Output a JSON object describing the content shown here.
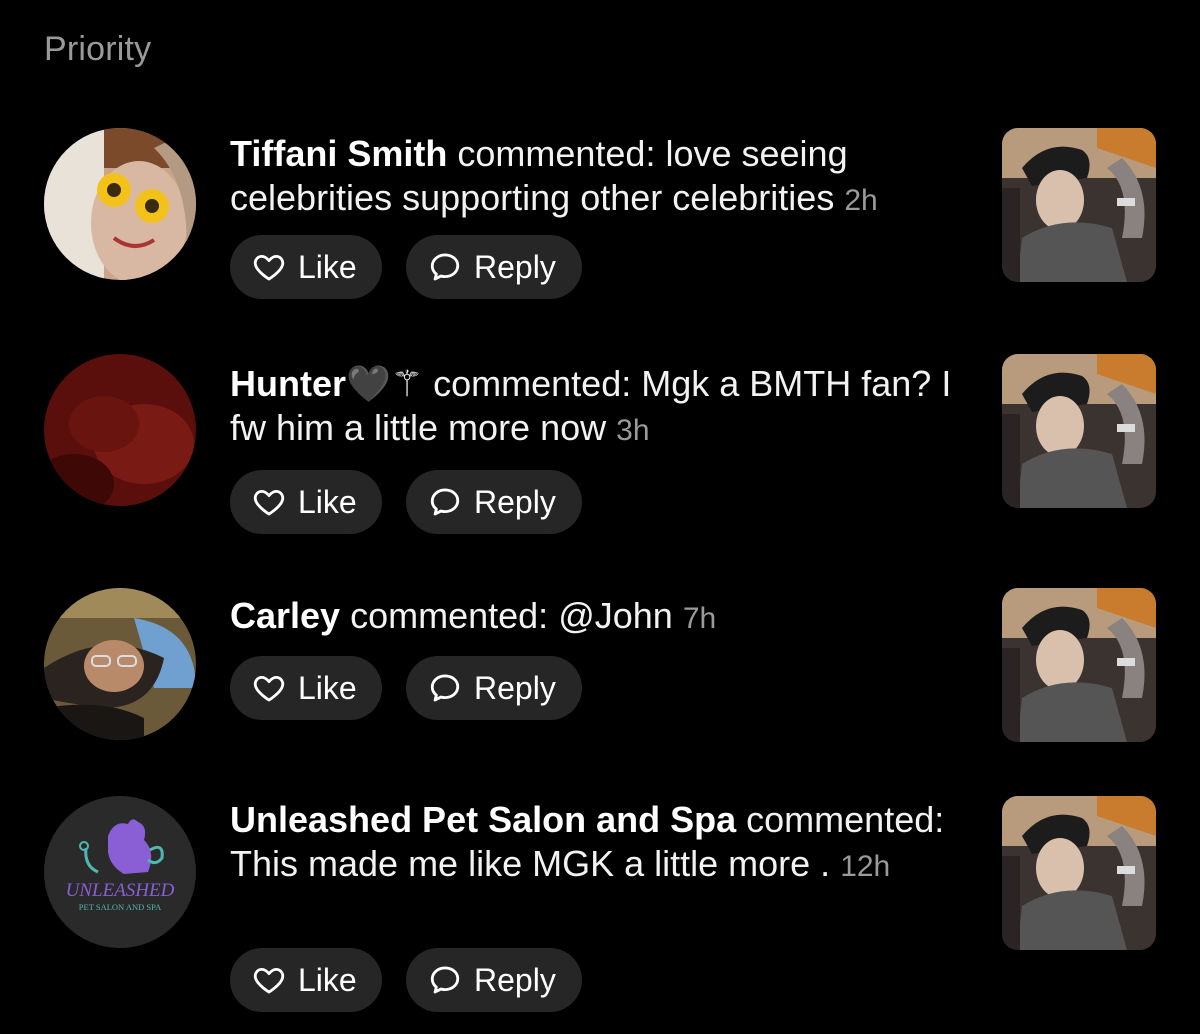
{
  "section_title": "Priority",
  "verb": "commented:",
  "like_label": "Like",
  "reply_label": "Reply",
  "notifications": [
    {
      "name": "Tiffani Smith",
      "badges": "",
      "text": "love seeing celebrities supporting other celebrities",
      "time": "2h",
      "avatar": "avatar-photo-sunflower-glasses"
    },
    {
      "name": "Hunter",
      "badges": "🖤⚚",
      "text": "Mgk a BMTH fan? I fw him a little more now",
      "time": "3h",
      "avatar": "avatar-photo-red"
    },
    {
      "name": "Carley",
      "badges": "",
      "text": "@John",
      "time": "7h",
      "avatar": "avatar-photo-woman-glasses"
    },
    {
      "name": "Unleashed Pet Salon and Spa",
      "badges": "",
      "text": "This made me like MGK a little more .",
      "time": "12h",
      "avatar": "avatar-logo-unleashed",
      "logo_text": "UNLEASHED",
      "logo_subtext": "PET SALON AND SPA"
    }
  ],
  "colors": {
    "background": "#000000",
    "button_bg": "#262626",
    "muted_text": "#9a9a9a",
    "logo_purple": "#8a5fd6",
    "logo_teal": "#4fb7b3"
  }
}
